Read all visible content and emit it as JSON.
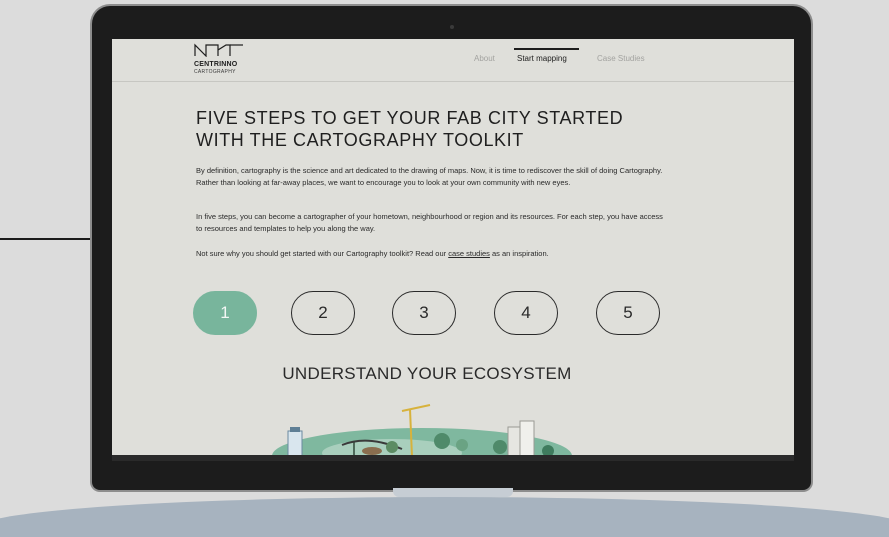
{
  "logo": {
    "name": "CENTRINNO",
    "sub": "CARTOGRAPHY"
  },
  "nav": {
    "items": [
      "About",
      "Start mapping",
      "Case Studies"
    ],
    "active": "Start mapping"
  },
  "page": {
    "title_line1": "FIVE STEPS TO GET YOUR FAB CITY STARTED",
    "title_line2": "WITH THE CARTOGRAPHY TOOLKIT",
    "para1": "By definition, cartography is the science and art dedicated to the drawing of maps. Now, it is time to rediscover the skill of doing Cartography. Rather than looking at far-away places, we want to encourage you to look at your own community with new eyes.",
    "para2": "In five steps, you can become a cartographer of your hometown, neighbourhood or region and its resources. For each step, you have access to resources and templates to help you along the way.",
    "para3_before": "Not sure why you should get started with our Cartography toolkit? Read our ",
    "para3_link": "case studies",
    "para3_after": " as an inspiration.",
    "steps": [
      "1",
      "2",
      "3",
      "4",
      "5"
    ],
    "active_step": "1",
    "step_heading": "UNDERSTAND YOUR ECOSYSTEM"
  },
  "colors": {
    "accent": "#78b59c",
    "screen_bg": "#dfdfda",
    "text": "#1f1f1f"
  },
  "icons": {
    "logo_mark": "centrinno-logo-icon",
    "illustration": "city-island-illustration-icon"
  }
}
